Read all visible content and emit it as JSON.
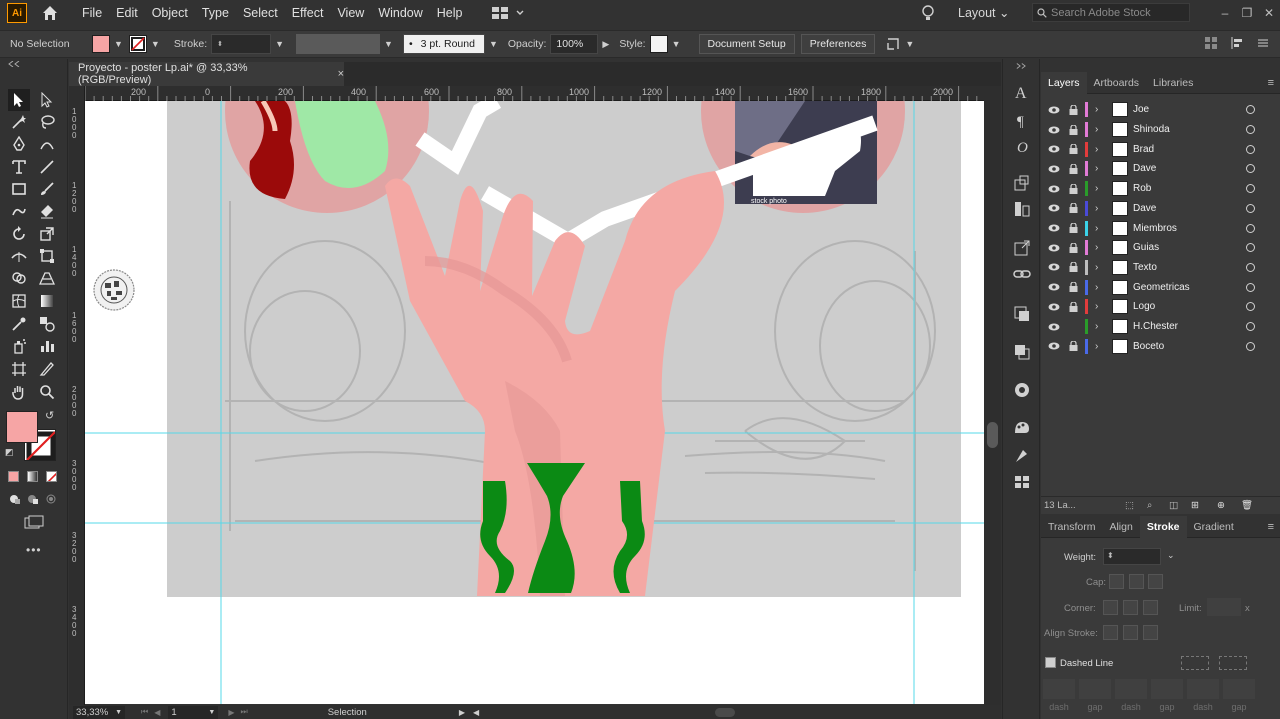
{
  "app": {
    "logo": "Ai"
  },
  "menu": [
    "File",
    "Edit",
    "Object",
    "Type",
    "Select",
    "Effect",
    "View",
    "Window",
    "Help"
  ],
  "workspace": {
    "label": "Layout",
    "search_placeholder": "Search Adobe Stock"
  },
  "controlbar": {
    "selection": "No Selection",
    "stroke_label": "Stroke:",
    "brush": "3 pt. Round",
    "opacity_label": "Opacity:",
    "opacity_value": "100%",
    "style_label": "Style:",
    "document_setup": "Document Setup",
    "preferences": "Preferences",
    "fill_color": "#f6a5a5"
  },
  "document": {
    "tab_title": "Proyecto - poster Lp.ai* @ 33,33% (RGB/Preview)",
    "close": "×"
  },
  "ruler": {
    "top_labels": [
      "200",
      "0",
      "200",
      "400",
      "600",
      "800",
      "1000",
      "1200",
      "1400",
      "1600",
      "1800",
      "2000"
    ],
    "left_labels": [
      "1000",
      "1200",
      "1400",
      "1600",
      "2000",
      "3000",
      "3200",
      "3400"
    ]
  },
  "canvas_art": {
    "stock_caption": "stock photo"
  },
  "status": {
    "zoom": "33,33%",
    "artboard": "1",
    "tool": "Selection"
  },
  "panels": {
    "top_tabs": [
      "Layers",
      "Artboards",
      "Libraries"
    ],
    "layers": [
      {
        "name": "Joe",
        "color": "#e27bd6"
      },
      {
        "name": "Shinoda",
        "color": "#e27bd6"
      },
      {
        "name": "Brad",
        "color": "#e23c3c"
      },
      {
        "name": "Dave",
        "color": "#e27bd6"
      },
      {
        "name": "Rob",
        "color": "#2a9c2a"
      },
      {
        "name": "Dave",
        "color": "#4a4ad8"
      },
      {
        "name": "Miembros",
        "color": "#3bd3e8"
      },
      {
        "name": "Guias",
        "color": "#e27bd6"
      },
      {
        "name": "Texto",
        "color": "#bdbdbd"
      },
      {
        "name": "Geometricas",
        "color": "#4a6ae8"
      },
      {
        "name": "Logo",
        "color": "#e23c3c"
      },
      {
        "name": "H.Chester",
        "color": "#2a9c2a"
      },
      {
        "name": "Boceto",
        "color": "#4a6ae8"
      }
    ],
    "layers_count": "13 La...",
    "bottom_tabs": [
      "Transform",
      "Align",
      "Stroke",
      "Gradient"
    ],
    "stroke": {
      "weight_label": "Weight:",
      "cap_label": "Cap:",
      "corner_label": "Corner:",
      "limit_label": "Limit:",
      "align_label": "Align Stroke:",
      "dashed_label": "Dashed Line",
      "dash_labels": [
        "dash",
        "gap",
        "dash",
        "gap",
        "dash",
        "gap"
      ]
    }
  }
}
